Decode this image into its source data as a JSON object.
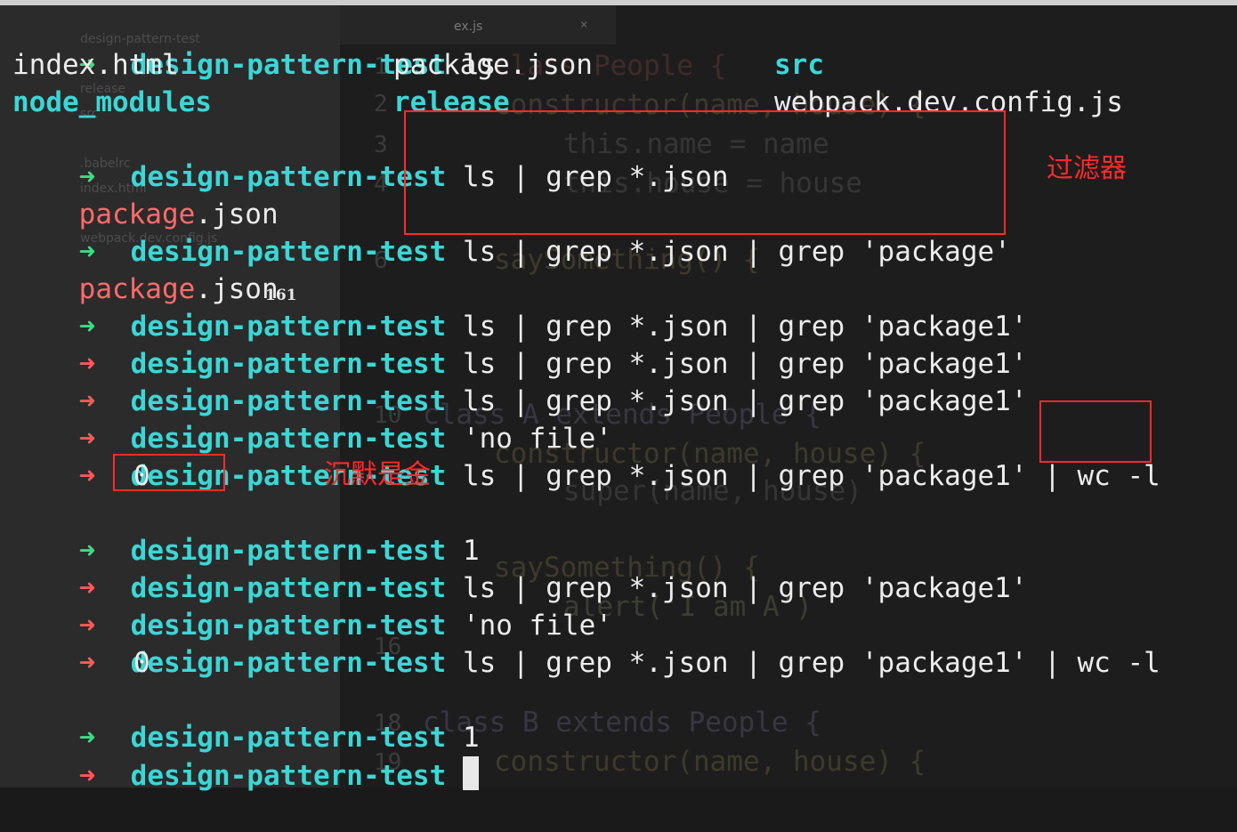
{
  "editor_ghost": {
    "sidebar": [
      "design-pattern-test",
      "release",
      "src",
      ".babelrc",
      "index.html",
      "webpack.dev.config.js"
    ],
    "lines": [
      {
        "num": "1",
        "text": "class People {"
      },
      {
        "num": "2",
        "text": "constructor(name, house) {"
      },
      {
        "num": "3",
        "text": "this.name = name"
      },
      {
        "num": "4",
        "text": "this.house = house"
      },
      {
        "num": "6",
        "text": "saySomething() {"
      },
      {
        "num": "10",
        "text": "class A extends People {"
      },
      {
        "num": "",
        "text": "constructor(name, house) {"
      },
      {
        "num": "",
        "text": "super(name, house)"
      },
      {
        "num": "",
        "text": "saySomething() {"
      },
      {
        "num": "",
        "text": "alert('I am A')"
      },
      {
        "num": "16",
        "text": ""
      },
      {
        "num": "18",
        "text": "class B extends People {"
      },
      {
        "num": "19",
        "text": "constructor(name, house) {"
      }
    ],
    "tab_label": "ex.js"
  },
  "terminal": {
    "prompt_dir": "design-pattern-test",
    "prompt_symbol": "➜",
    "lines": [
      {
        "kind": "ok",
        "cmd": "ls"
      },
      {
        "kind": "ls_out_1",
        "c1": "index.html",
        "c2": "package.json",
        "c3": "src"
      },
      {
        "kind": "ls_out_2",
        "c1": "node_modules",
        "c2": "release",
        "c3": "webpack.dev.config.js"
      },
      {
        "kind": "ok",
        "cmd": "ls | grep *.json"
      },
      {
        "kind": "match",
        "m": "package",
        "rest": ".json"
      },
      {
        "kind": "ok",
        "cmd": "ls | grep *.json | grep 'package'"
      },
      {
        "kind": "match",
        "m": "package",
        "rest": ".json"
      },
      {
        "kind": "ok",
        "cmd": "ls | grep *.json | grep 'package1'"
      },
      {
        "kind": "err",
        "cmd": "ls | grep *.json | grep 'package1'"
      },
      {
        "kind": "err",
        "cmd": "ls | grep *.json | grep 'package1'"
      },
      {
        "kind": "err",
        "cmd": "'no file'"
      },
      {
        "kind": "err",
        "cmd": "ls | grep *.json | grep 'package1' | wc -l"
      },
      {
        "kind": "plain",
        "text": "0"
      },
      {
        "kind": "ok",
        "cmd": "1"
      },
      {
        "kind": "err",
        "cmd": "ls | grep *.json | grep 'package1'"
      },
      {
        "kind": "err",
        "cmd": "'no file'"
      },
      {
        "kind": "err",
        "cmd": "ls | grep *.json | grep 'package1' | wc -l"
      },
      {
        "kind": "plain",
        "text": "0"
      },
      {
        "kind": "ok",
        "cmd": "1"
      },
      {
        "kind": "err_cursor",
        "cmd": ""
      }
    ]
  },
  "annotations": {
    "filter_label": "过滤器",
    "silence_label": "沉默是金"
  },
  "page_number": "161",
  "colors": {
    "ok_arrow": "#3ddc84",
    "err_arrow": "#ff5a5a",
    "dir": "#3cd6d6",
    "match": "#ff6b6b",
    "annotation": "#ff2a2a"
  }
}
